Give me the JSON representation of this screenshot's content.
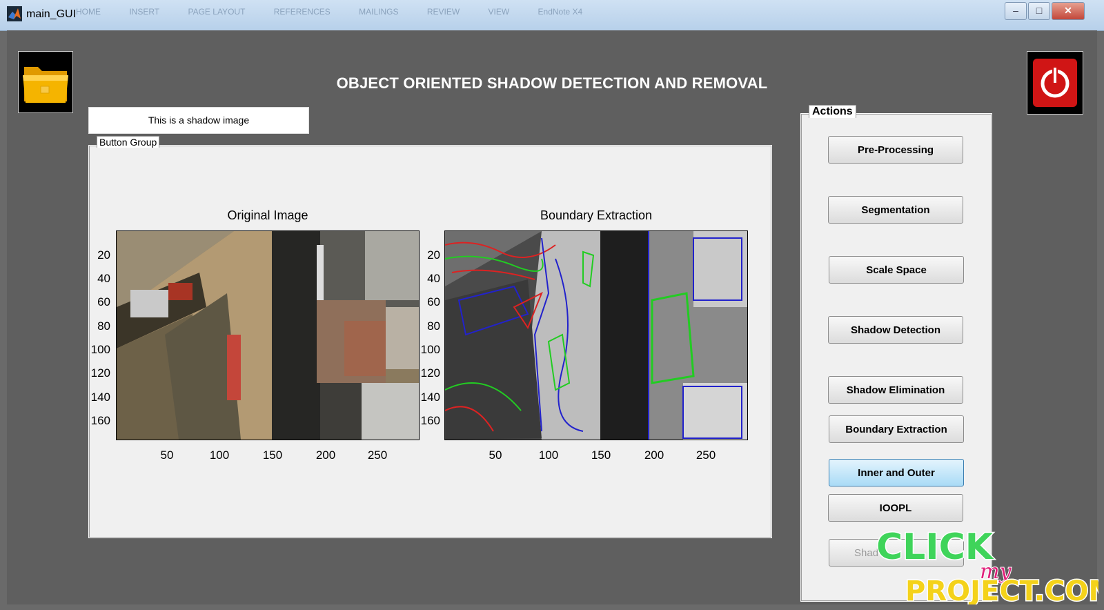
{
  "window": {
    "title": "main_GUI",
    "ghost_tabs": [
      "HOME",
      "INSERT",
      "PAGE LAYOUT",
      "REFERENCES",
      "MAILINGS",
      "REVIEW",
      "VIEW",
      "EndNote X4"
    ]
  },
  "header": {
    "title": "OBJECT ORIENTED SHADOW DETECTION AND REMOVAL"
  },
  "status_text": "This is a shadow image",
  "button_group": {
    "label": "Button Group"
  },
  "axes": [
    {
      "title": "Original Image",
      "yticks": [
        "20",
        "40",
        "60",
        "80",
        "100",
        "120",
        "140",
        "160"
      ],
      "xticks": [
        "50",
        "100",
        "150",
        "200",
        "250"
      ]
    },
    {
      "title": "Boundary Extraction",
      "yticks": [
        "20",
        "40",
        "60",
        "80",
        "100",
        "120",
        "140",
        "160"
      ],
      "xticks": [
        "50",
        "100",
        "150",
        "200",
        "250"
      ]
    }
  ],
  "actions": {
    "label": "Actions",
    "buttons": [
      {
        "label": "Pre-Processing"
      },
      {
        "label": "Segmentation"
      },
      {
        "label": "Scale Space"
      },
      {
        "label": "Shadow Detection"
      },
      {
        "label": "Shadow Elimination"
      },
      {
        "label": "Boundary Extraction"
      },
      {
        "label": "Inner and Outer"
      },
      {
        "label": "IOOPL"
      },
      {
        "label": "Shad"
      }
    ]
  },
  "watermark": {
    "line1": "CLICK",
    "line2": "my",
    "line3": "PROJECT.COM"
  },
  "icons": {
    "open": "folder-icon",
    "power": "power-icon",
    "app": "matlab-icon"
  },
  "colors": {
    "accent_active": "#a9dbf6",
    "power_red": "#d01515",
    "folder_yellow": "#f5b400"
  }
}
